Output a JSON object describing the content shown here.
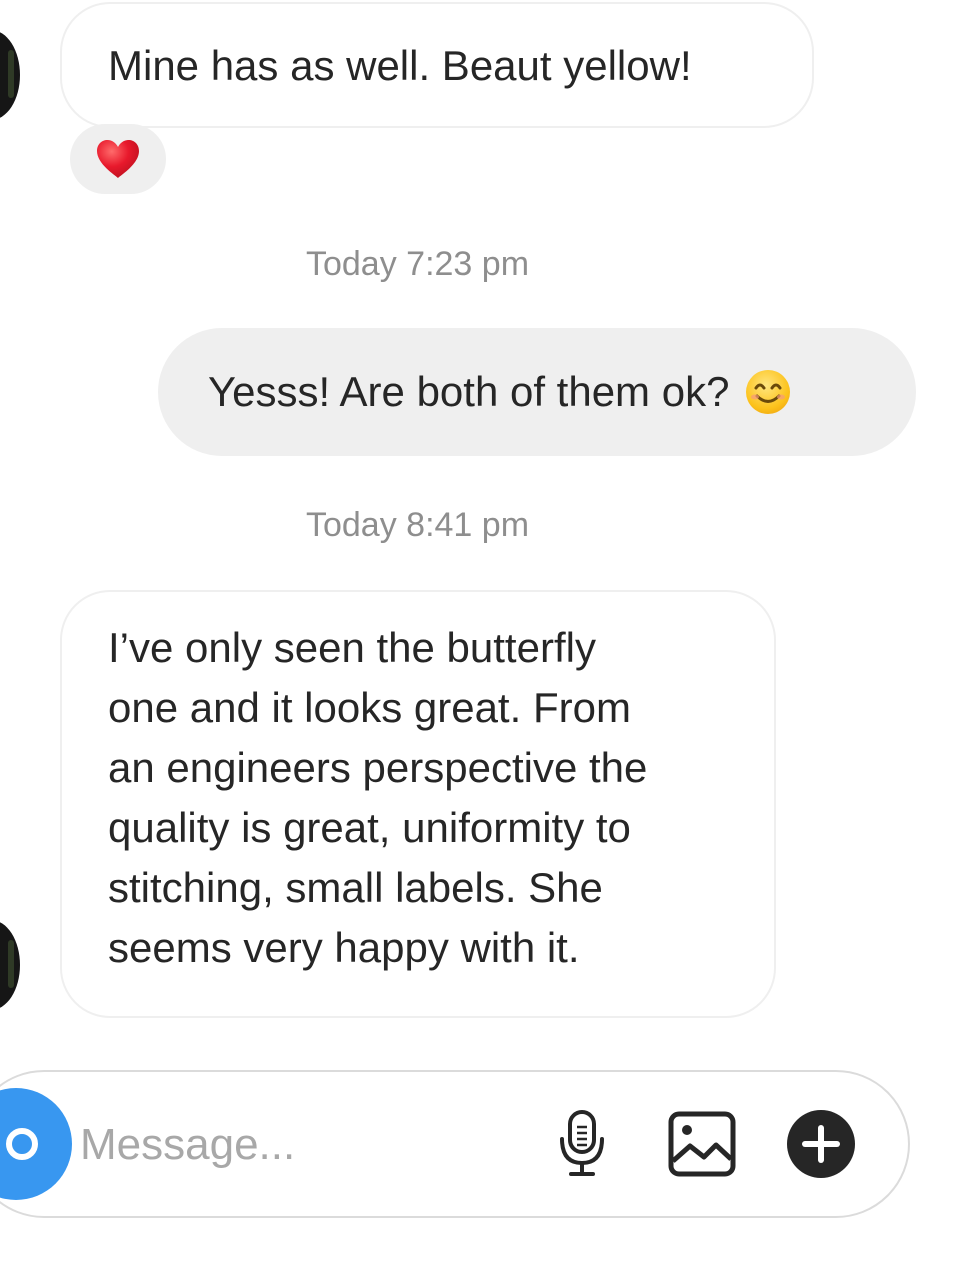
{
  "messages": [
    {
      "text": "Mine has as well. Beaut yellow!",
      "direction": "incoming"
    },
    {
      "text": "Yesss! Are both of them ok?",
      "direction": "outgoing",
      "emoji": "smiling-face-icon"
    },
    {
      "text": "I’ve only seen the butterfly\none and it looks great. From\nan engineers perspective the\nquality is great, uniformity to\nstitching, small labels. She\nseems very happy with it.",
      "direction": "incoming"
    }
  ],
  "reaction": {
    "icon": "red-heart-icon",
    "color": "#e8192c"
  },
  "timestamps": [
    "Today 7:23 pm",
    "Today 8:41 pm"
  ],
  "composer": {
    "placeholder": "Message...",
    "value": "",
    "icons": [
      "camera-icon",
      "microphone-icon",
      "gallery-icon",
      "plus-icon"
    ],
    "accent_color": "#3897f0"
  }
}
